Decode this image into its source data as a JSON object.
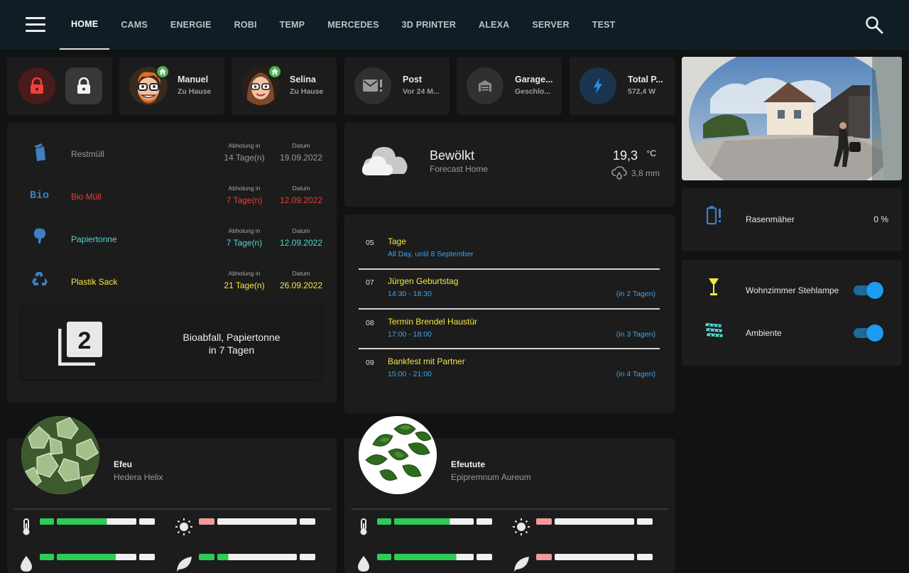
{
  "nav": {
    "tabs": [
      "HOME",
      "CAMS",
      "ENERGIE",
      "ROBI",
      "TEMP",
      "MERCEDES",
      "3D PRINTER",
      "ALEXA",
      "SERVER",
      "TEST"
    ],
    "active_tab": "HOME"
  },
  "chips": {
    "manuel": {
      "name": "Manuel",
      "status": "Zu Hause"
    },
    "selina": {
      "name": "Selina",
      "status": "Zu Hause"
    },
    "post": {
      "name": "Post",
      "status": "Vor 24 M..."
    },
    "garage": {
      "name": "Garage...",
      "status": "Geschlo..."
    },
    "power": {
      "name": "Total P...",
      "status": "572,4 W"
    }
  },
  "trash": {
    "col_pickup": "Abholung in",
    "col_date": "Datum",
    "items": [
      {
        "name": "Restmüll",
        "in": "14 Tage(n)",
        "date": "19.09.2022",
        "color": "#9a9a9a"
      },
      {
        "name": "Bio Müll",
        "in": "7 Tage(n)",
        "date": "12.09.2022",
        "color": "#e0403c"
      },
      {
        "name": "Papiertonne",
        "in": "7 Tage(n)",
        "date": "12.09.2022",
        "color": "#4fd6d0"
      },
      {
        "name": "Plastik Sack",
        "in": "21 Tage(n)",
        "date": "26.09.2022",
        "color": "#f5e642"
      }
    ],
    "next_icon_number": "2",
    "next_line1": "Bioabfall, Papiertonne",
    "next_line2": "in 7 Tagen"
  },
  "weather": {
    "condition": "Bewölkt",
    "location": "Forecast Home",
    "temp": "19,3",
    "unit": "°C",
    "precip": "3,8 mm"
  },
  "calendar": [
    {
      "day": "05",
      "title": "Tage",
      "time": "All Day, until 8 September",
      "rel": ""
    },
    {
      "day": "07",
      "title": "Jürgen Geburtstag",
      "time": "14:30 - 18:30",
      "rel": "(in 2 Tagen)"
    },
    {
      "day": "08",
      "title": "Termin Brendel Haustür",
      "time": "17:00 - 18:00",
      "rel": "(in 3 Tagen)"
    },
    {
      "day": "09",
      "title": "Bankfest mit Partner",
      "time": "15:00 - 21:00",
      "rel": "(in 4 Tagen)"
    }
  ],
  "mower": {
    "name": "Rasenmäher",
    "value": "0 %"
  },
  "lights": [
    {
      "name": "Wohnzimmer Stehlampe",
      "on": true
    },
    {
      "name": "Ambiente",
      "on": true
    }
  ],
  "plants": [
    {
      "name": "Efeu",
      "scientific": "Hedera Helix"
    },
    {
      "name": "Efeutute",
      "scientific": "Epipremnum Aureum"
    }
  ],
  "colors": {
    "accent": "#1e9bf0",
    "alarm_red": "#e53935",
    "good_green": "#2ecc55",
    "warn_pink": "#f09a9a",
    "calendar_yellow": "#f5e642",
    "calendar_blue": "#3da5ee"
  }
}
